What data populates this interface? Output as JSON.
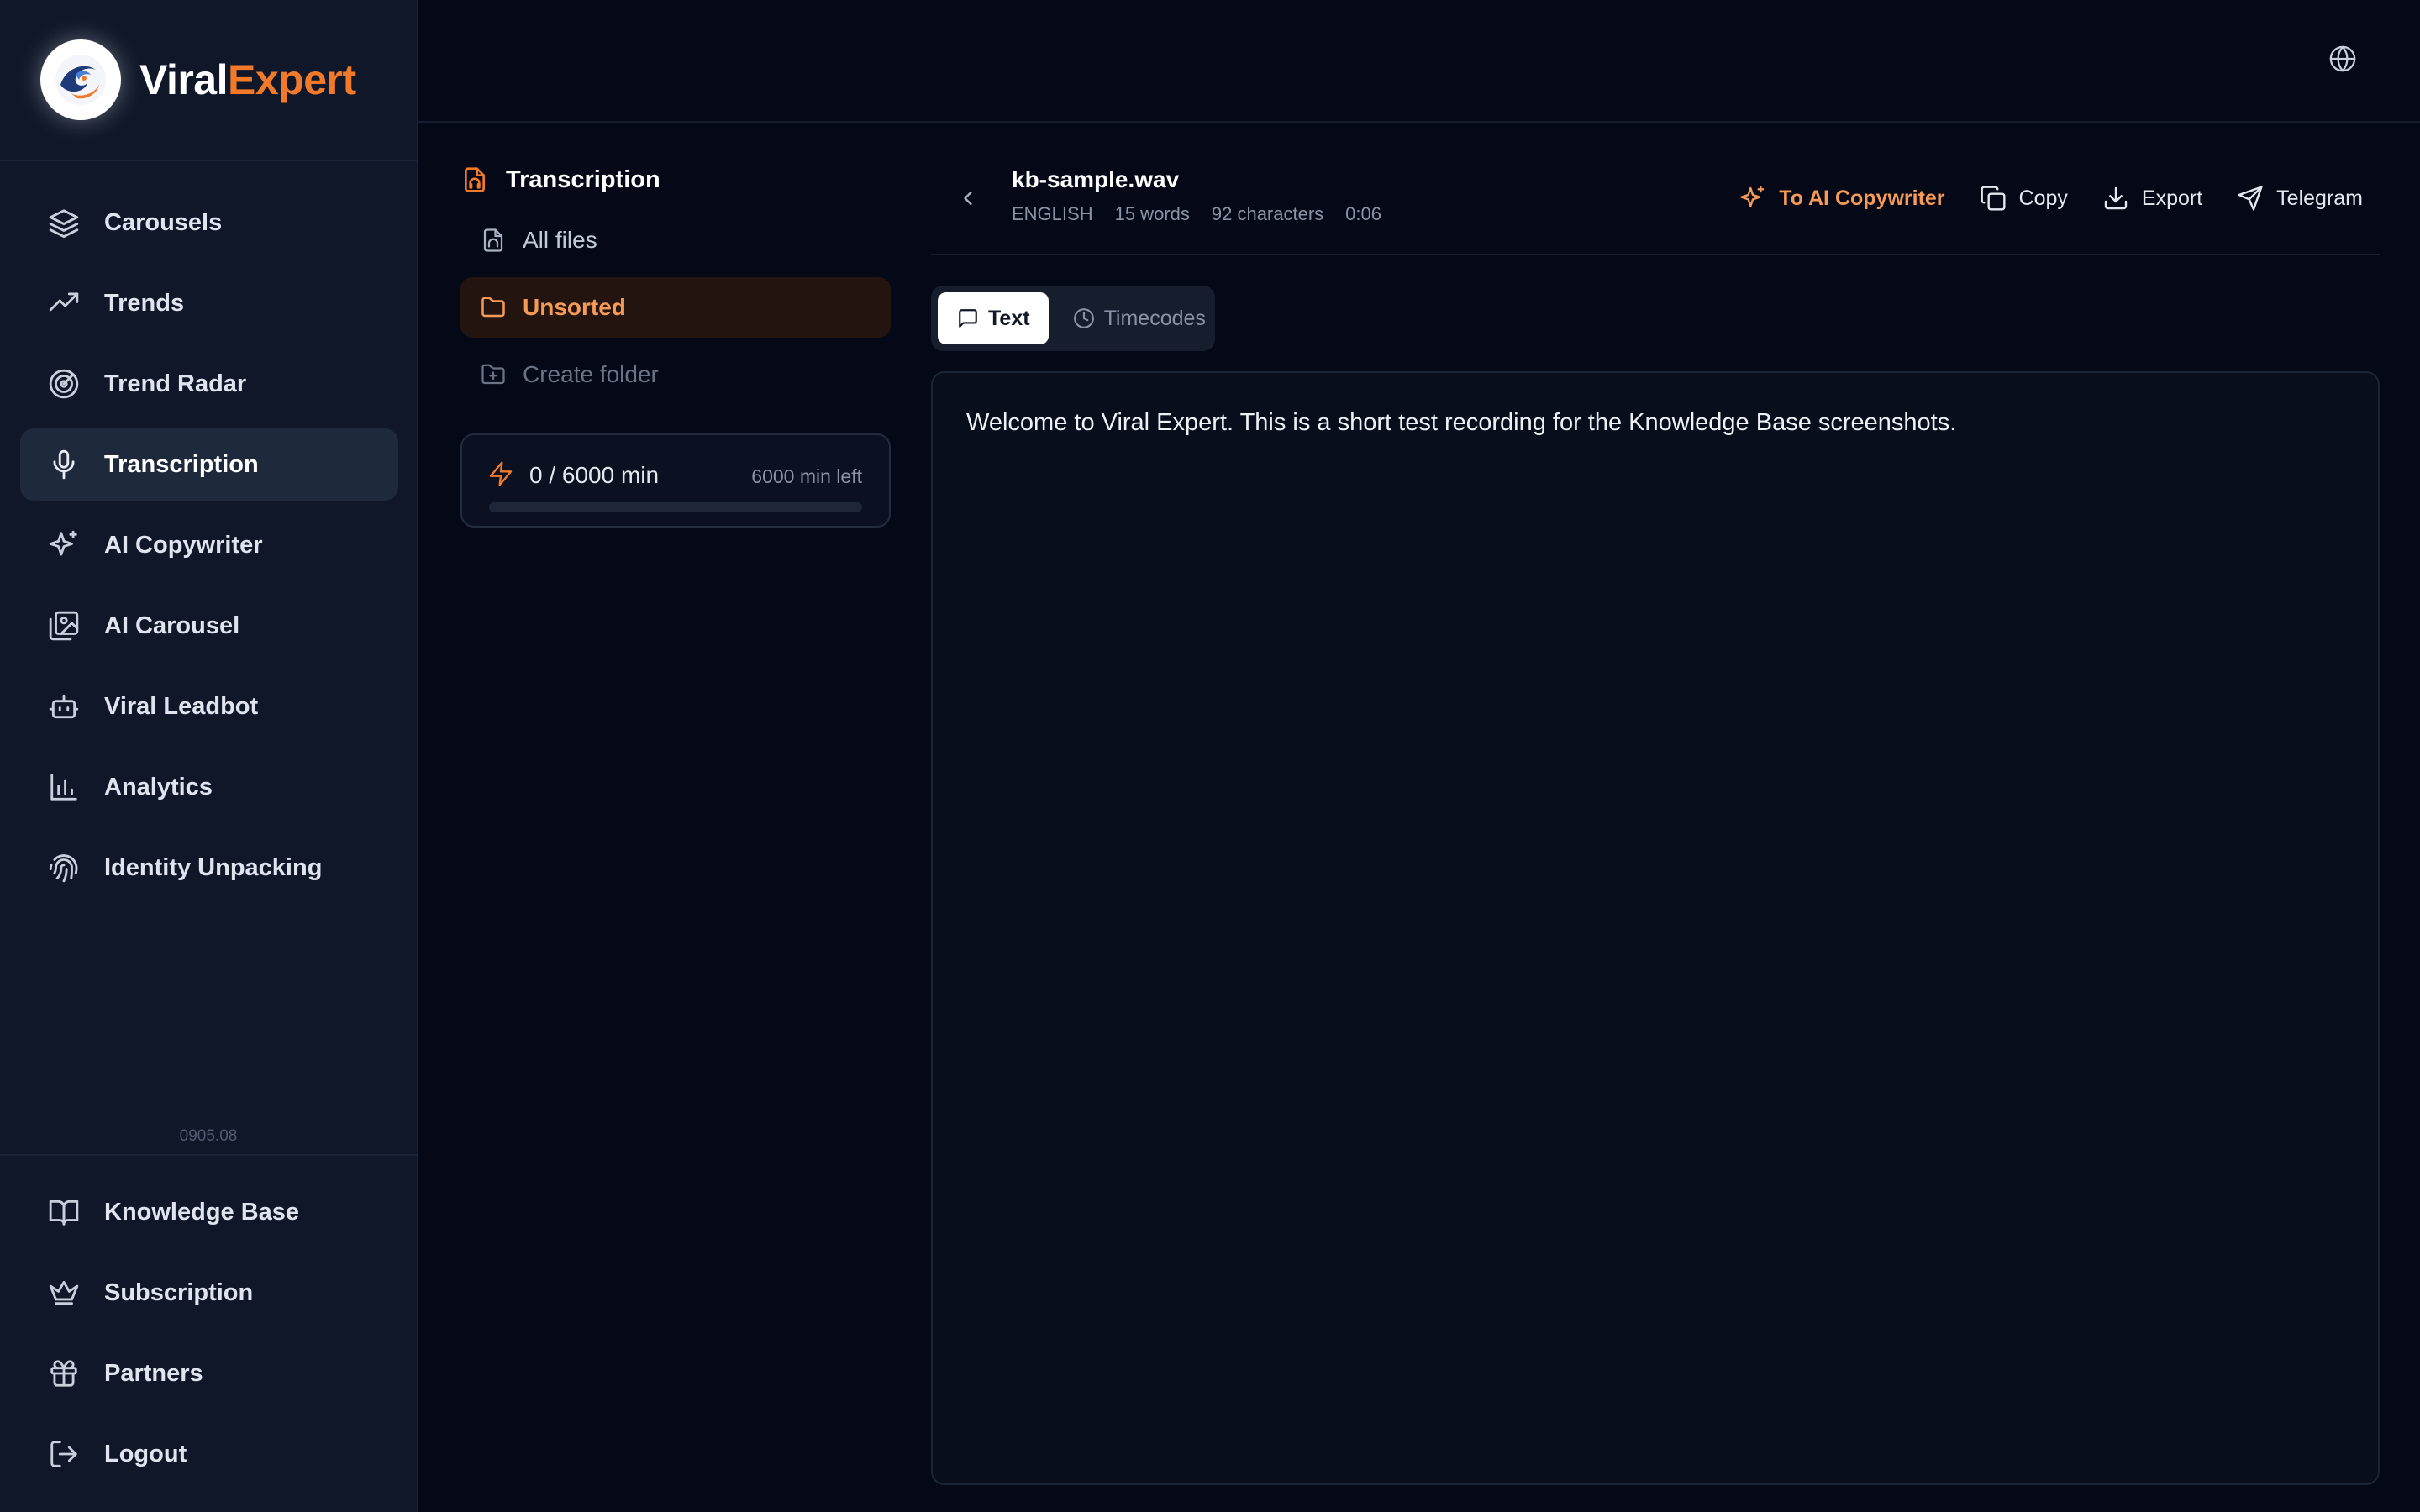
{
  "brand": {
    "name_white": "Viral",
    "name_orange": "Expert",
    "accent": "#f07a2a"
  },
  "sidebar": {
    "items": [
      {
        "label": "Carousels",
        "icon": "layers-icon"
      },
      {
        "label": "Trends",
        "icon": "trending-up-icon"
      },
      {
        "label": "Trend Radar",
        "icon": "radar-icon"
      },
      {
        "label": "Transcription",
        "icon": "mic-icon",
        "active": true
      },
      {
        "label": "AI Copywriter",
        "icon": "sparkles-icon"
      },
      {
        "label": "AI Carousel",
        "icon": "images-icon"
      },
      {
        "label": "Viral Leadbot",
        "icon": "bot-icon"
      },
      {
        "label": "Analytics",
        "icon": "bar-chart-icon"
      },
      {
        "label": "Identity Unpacking",
        "icon": "fingerprint-icon"
      }
    ],
    "version": "0905.08",
    "bottom_items": [
      {
        "label": "Knowledge Base",
        "icon": "book-icon"
      },
      {
        "label": "Subscription",
        "icon": "crown-icon"
      },
      {
        "label": "Partners",
        "icon": "gift-icon"
      },
      {
        "label": "Logout",
        "icon": "logout-icon"
      }
    ]
  },
  "topbar": {
    "language_icon": "globe-icon"
  },
  "folders": {
    "title": "Transcription",
    "items": [
      {
        "label": "All files",
        "icon": "file-audio-icon"
      },
      {
        "label": "Unsorted",
        "icon": "folder-icon",
        "active": true
      },
      {
        "label": "Create folder",
        "icon": "folder-plus-icon"
      }
    ],
    "quota": {
      "used_label": "0 / 6000 min",
      "left_label": "6000 min left",
      "used_fraction": 0.0
    }
  },
  "file": {
    "name": "kb-sample.wav",
    "language": "ENGLISH",
    "words": "15 words",
    "characters": "92 characters",
    "duration": "0:06"
  },
  "actions": {
    "to_copywriter": "To AI Copywriter",
    "copy": "Copy",
    "export": "Export",
    "telegram": "Telegram"
  },
  "tabs": {
    "text": "Text",
    "timecodes": "Timecodes"
  },
  "transcript": {
    "text": "Welcome to Viral Expert. This is a short test recording for the Knowledge Base screenshots."
  }
}
